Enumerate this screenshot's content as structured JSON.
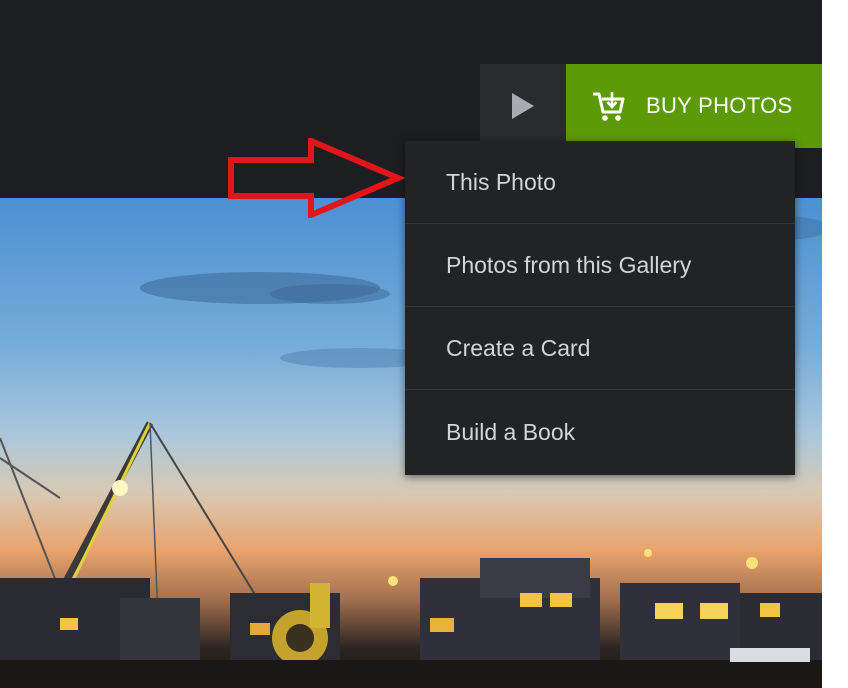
{
  "header": {
    "play_button": {
      "icon": "play-icon"
    },
    "buy_button": {
      "icon": "cart-icon",
      "label": "BUY PHOTOS",
      "color": "#5c9a07"
    }
  },
  "dropdown": {
    "items": [
      {
        "label": "This Photo"
      },
      {
        "label": "Photos from this Gallery"
      },
      {
        "label": "Create a Card"
      },
      {
        "label": "Build a Book"
      }
    ]
  },
  "annotation": {
    "icon": "red-arrow-icon",
    "color": "#e3151a"
  }
}
